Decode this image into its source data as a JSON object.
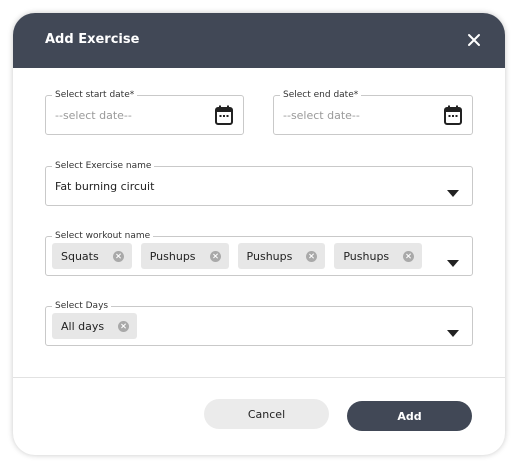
{
  "dialog": {
    "title": "Add Exercise",
    "close_icon": "close-icon",
    "header_color": "#414856"
  },
  "start_date": {
    "label": "Select start date*",
    "placeholder": "--select date--",
    "icon": "calendar-icon"
  },
  "end_date": {
    "label": "Select end date*",
    "placeholder": "--select date--",
    "icon": "calendar-icon"
  },
  "exercise": {
    "label": "Select Exercise name",
    "value": "Fat burning circuit",
    "icon": "chevron-down-icon"
  },
  "workout": {
    "label": "Select workout name",
    "chips": [
      "Squats",
      "Pushups",
      "Pushups",
      "Pushups"
    ],
    "icon": "chevron-down-icon"
  },
  "days": {
    "label": "Select Days",
    "chips": [
      "All days"
    ],
    "icon": "chevron-down-icon"
  },
  "footer": {
    "cancel_label": "Cancel",
    "add_label": "Add",
    "add_color": "#414856"
  }
}
